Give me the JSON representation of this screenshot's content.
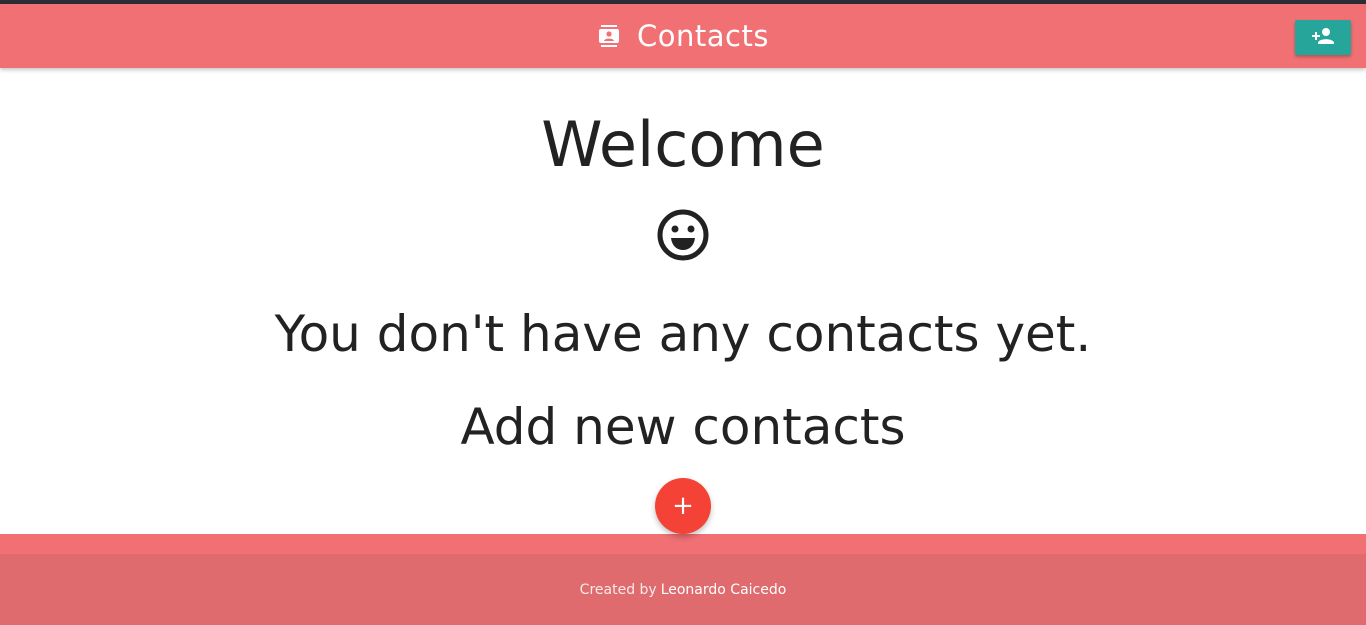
{
  "colors": {
    "navbar": "#f07074",
    "footer_copyright": "#e06b6f",
    "add_button": "#26a69a",
    "fab": "#f44336",
    "text": "#222222"
  },
  "navbar": {
    "brand_icon": "contacts-icon",
    "brand_text": "Contacts",
    "action_icon": "person-add-icon"
  },
  "main": {
    "welcome": "Welcome",
    "smile_icon": "smile-icon",
    "empty_message": "You don't have any contacts yet.",
    "add_message": "Add new contacts",
    "fab_label": "+"
  },
  "footer": {
    "created_by": "Created by",
    "author": "Leonardo Caicedo"
  }
}
